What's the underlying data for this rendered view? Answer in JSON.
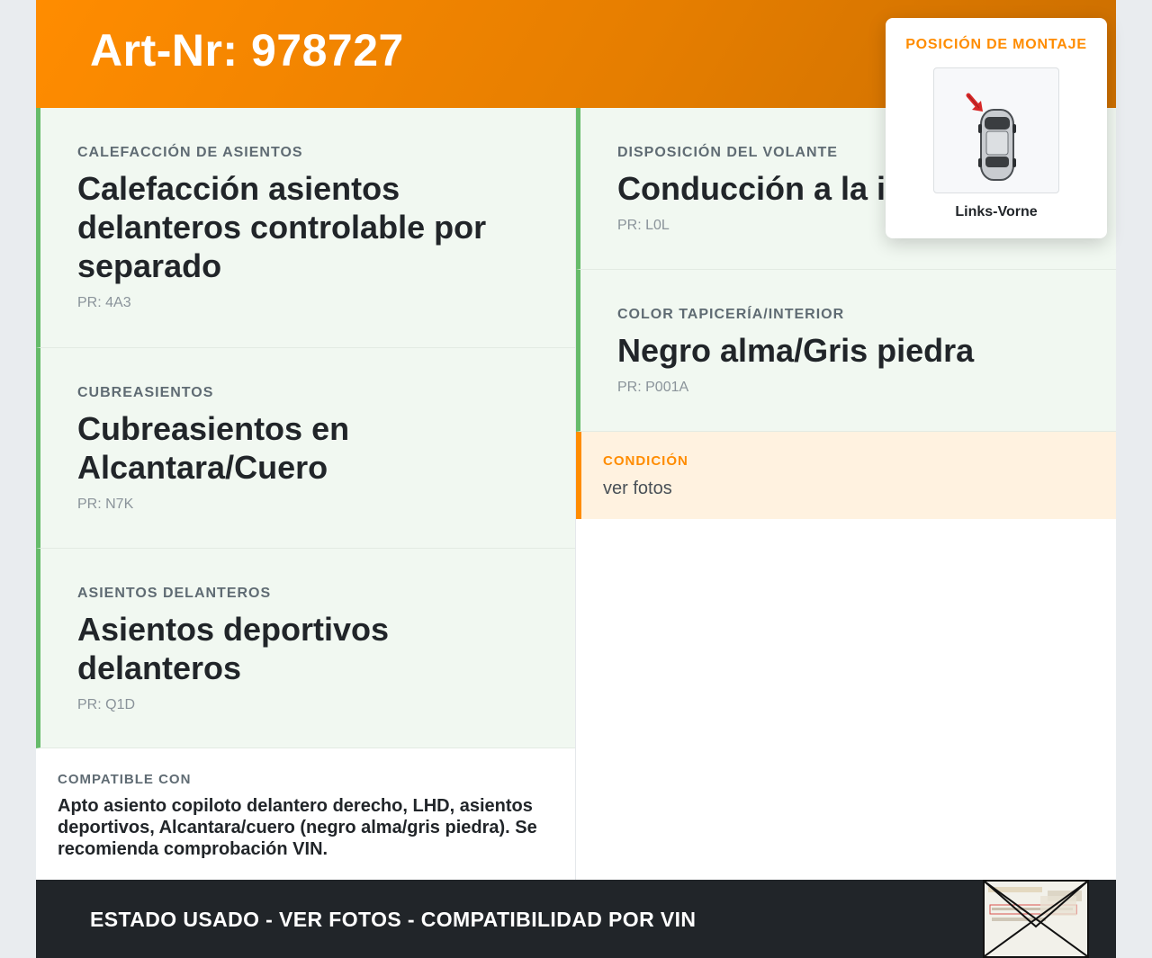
{
  "header": {
    "title": "Art-Nr: 978727"
  },
  "left_cards": [
    {
      "label": "CALEFACCIÓN DE ASIENTOS",
      "value": "Calefacción asientos delanteros controlable por separado",
      "pr": "PR: 4A3"
    },
    {
      "label": "CUBREASIENTOS",
      "value": "Cubreasientos en Alcantara/Cuero",
      "pr": "PR: N7K"
    },
    {
      "label": "ASIENTOS DELANTEROS",
      "value": "Asientos deportivos delanteros",
      "pr": "PR: Q1D"
    }
  ],
  "right_cards": [
    {
      "label": "DISPOSICIÓN DEL VOLANTE",
      "value": "Conducción a la i",
      "pr": "PR: L0L"
    },
    {
      "label": "COLOR TAPICERÍA/INTERIOR",
      "value": "Negro alma/Gris piedra",
      "pr": "PR: P001A"
    }
  ],
  "condition": {
    "label": "CONDICIÓN",
    "text": "ver fotos"
  },
  "compatible": {
    "label": "COMPATIBLE CON",
    "text": "Apto asiento copiloto delantero derecho, LHD, asientos deportivos, Alcantara/cuero (negro alma/gris piedra). Se recomienda comprobación VIN."
  },
  "footer": {
    "text": "ESTADO USADO - VER FOTOS - COMPATIBILIDAD POR VIN"
  },
  "mount_popup": {
    "title": "POSICIÓN DE MONTAJE",
    "caption": "Links-Vorne",
    "icon": "car-top-view-icon",
    "arrow_icon": "front-left-arrow-icon"
  },
  "colors": {
    "accent_orange": "#ff8c00",
    "card_green_border": "#66bb6a",
    "card_bg": "#f1f8f1",
    "footer_bg": "#212529",
    "condition_bg": "#fff2e0"
  }
}
